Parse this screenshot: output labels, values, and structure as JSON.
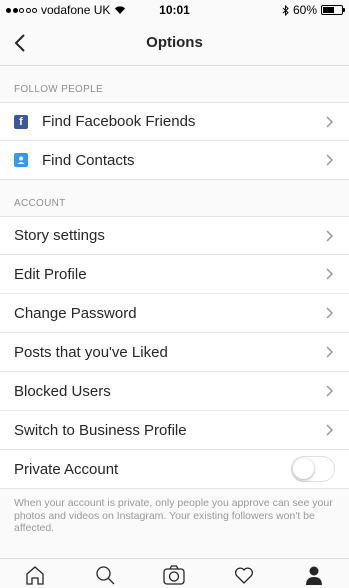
{
  "status_bar": {
    "carrier": "vodafone UK",
    "time": "10:01",
    "battery_percent": "60%",
    "battery_level": 0.6
  },
  "header": {
    "title": "Options"
  },
  "follow_people": {
    "header": "FOLLOW PEOPLE",
    "items": [
      {
        "label": "Find Facebook Friends",
        "icon": "facebook-icon"
      },
      {
        "label": "Find Contacts",
        "icon": "contacts-icon"
      }
    ]
  },
  "account": {
    "header": "ACCOUNT",
    "items": [
      {
        "label": "Story settings"
      },
      {
        "label": "Edit Profile"
      },
      {
        "label": "Change Password"
      },
      {
        "label": "Posts that you've Liked"
      },
      {
        "label": "Blocked Users"
      },
      {
        "label": "Switch to Business Profile"
      }
    ],
    "private_account": {
      "label": "Private Account",
      "enabled": false,
      "note": "When your account is private, only people you approve can see your photos and videos on Instagram. Your existing followers won't be affected."
    }
  },
  "tabs": [
    "home-icon",
    "search-icon",
    "camera-icon",
    "heart-icon",
    "profile-icon"
  ]
}
